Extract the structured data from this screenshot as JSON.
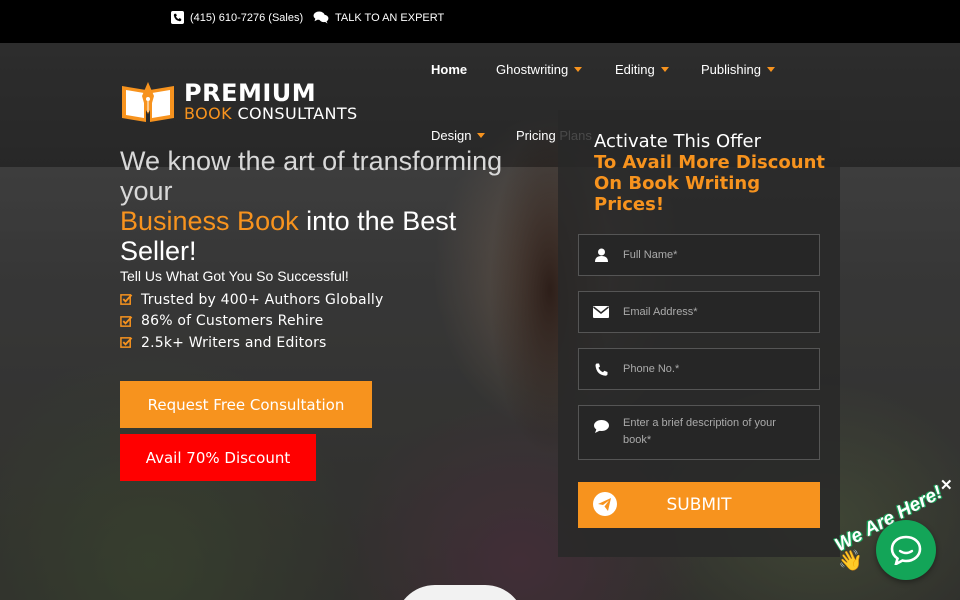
{
  "topbar": {
    "phone": "(415) 610-7276 (Sales)",
    "expert": "TALK TO AN EXPERT",
    "phone_icon": "phone-square-icon",
    "chat_icon": "comments-icon"
  },
  "logo": {
    "line1": "PREMIUM",
    "line2_orange": "BOOK",
    "line2_white": "CONSULTANTS",
    "icon": "open-book-pen-icon"
  },
  "nav": {
    "items": [
      {
        "label": "Home",
        "active": true,
        "dropdown": false
      },
      {
        "label": "Ghostwriting",
        "active": false,
        "dropdown": true
      },
      {
        "label": "Editing",
        "active": false,
        "dropdown": true
      },
      {
        "label": "Publishing",
        "active": false,
        "dropdown": true
      },
      {
        "label": "Design",
        "active": false,
        "dropdown": true
      },
      {
        "label": "Pricing Plans",
        "active": false,
        "dropdown": false
      }
    ]
  },
  "hero": {
    "headline_part1": "We know the art of transforming your",
    "headline_highlight": "Business Book",
    "headline_part2": "into the Best Seller!",
    "subline": "Tell Us What Got You So Successful!",
    "checks": [
      "Trusted by 400+ Authors Globally",
      "86% of Customers Rehire",
      "2.5k+ Writers and Editors"
    ],
    "btn_consult": "Request Free Consultation",
    "btn_discount": "Avail 70% Discount"
  },
  "form": {
    "title_line1": "Activate This Offer",
    "title_line2": "To Avail More Discount",
    "title_line3": "On Book Writing",
    "title_line4": "Prices!",
    "name_placeholder": "Full Name*",
    "email_placeholder": "Email Address*",
    "phone_placeholder": "Phone No.*",
    "desc_placeholder": "Enter a brief description of your book*",
    "submit": "SUBMIT"
  },
  "chat": {
    "close": "✕",
    "greeting": "We Are Here!",
    "wave": "👋"
  },
  "colors": {
    "accent": "#f7931e",
    "discount": "#ff0000",
    "chat": "#13a558"
  }
}
